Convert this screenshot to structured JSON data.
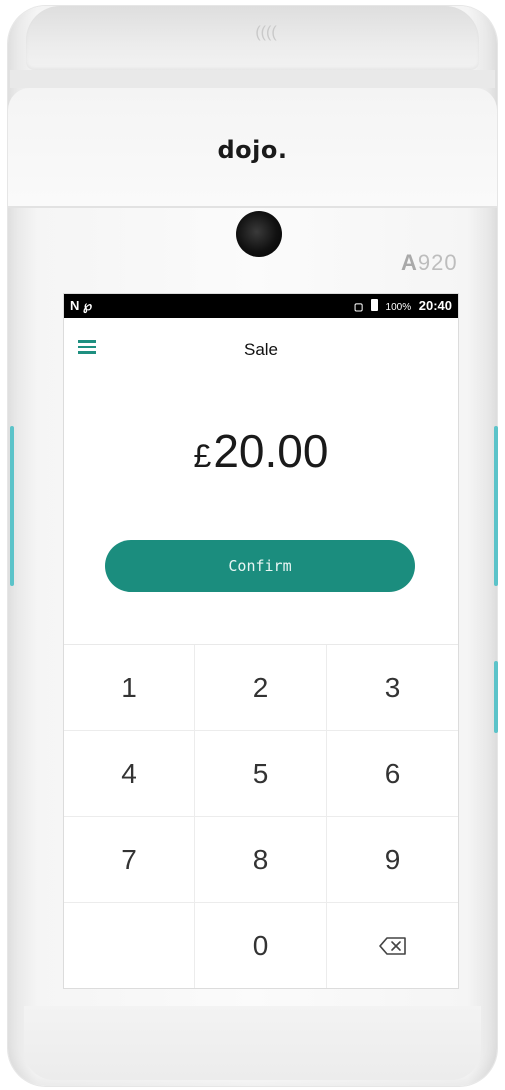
{
  "device": {
    "brand": "dojo.",
    "model_prefix": "A",
    "model_number": "920"
  },
  "statusbar": {
    "left_icons": "N ℘",
    "battery_percent": "100%",
    "time": "20:40"
  },
  "appbar": {
    "title": "Sale",
    "menu_icon": "hamburger-menu-icon"
  },
  "amount": {
    "currency": "£",
    "value": "20.00"
  },
  "confirm_label": "Confirm",
  "keypad": {
    "keys": [
      "1",
      "2",
      "3",
      "4",
      "5",
      "6",
      "7",
      "8",
      "9",
      "",
      "0"
    ],
    "backspace_icon": "backspace-icon"
  },
  "colors": {
    "accent": "#1b8d7e",
    "side_accent": "#5cc3c9"
  }
}
